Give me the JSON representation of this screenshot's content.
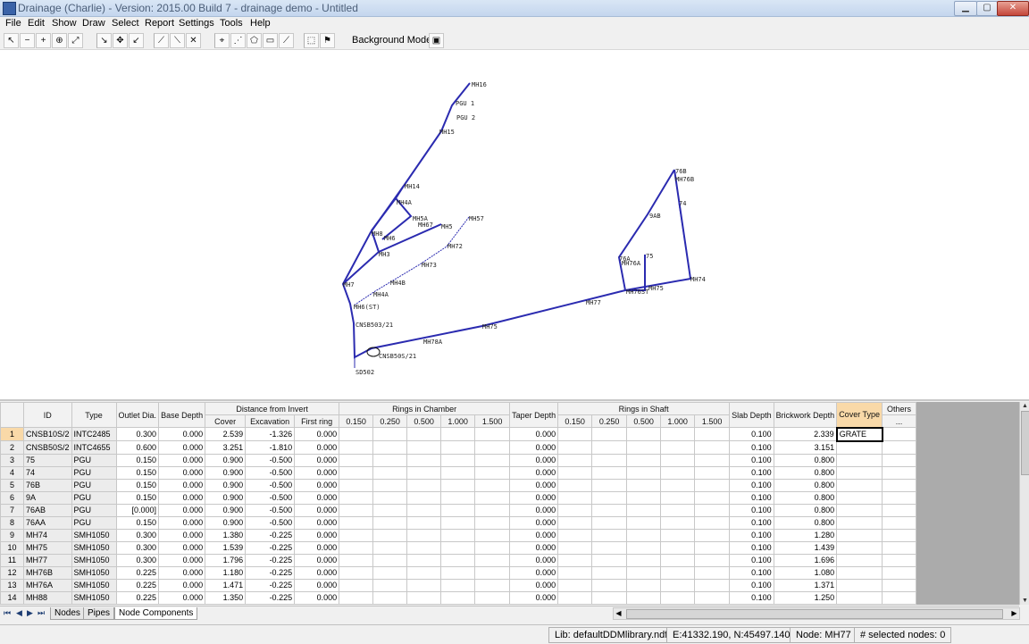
{
  "window": {
    "title": "Drainage (Charlie) - Version: 2015.00 Build 7 - drainage demo - Untitled"
  },
  "menu": [
    "File",
    "Edit",
    "Show",
    "Draw",
    "Select",
    "Report",
    "Settings",
    "Tools",
    "Help"
  ],
  "toolbar": {
    "background_label": "Background Models:"
  },
  "map": {
    "node_labels": [
      "MH16",
      "PGU 1",
      "PGU 2",
      "MH15",
      "MH14",
      "MH4A",
      "MH5A",
      "MH67",
      "MH8",
      "MH6",
      "MH5",
      "MH57",
      "MH72",
      "MH3",
      "MH73",
      "MH4B",
      "MH7",
      "MH4A",
      "MH6(ST)",
      "CNSB503/21",
      "MH78A",
      "MH75",
      "CNSB50S/21",
      "SD502",
      "MH77",
      "MH76ST",
      "MH75",
      "MH74",
      "76B",
      "MH76B",
      "74",
      "9AB",
      "76A",
      "MH76A",
      "75"
    ]
  },
  "grid": {
    "group_headers": {
      "distance": "Distance from Invert",
      "rings_chamber": "Rings in Chamber",
      "rings_shaft": "Rings in Shaft"
    },
    "columns": {
      "id": "ID",
      "type": "Type",
      "outlet": "Outlet Dia.",
      "base": "Base Depth",
      "cover": "Cover",
      "excavation": "Excavation",
      "first_ring": "First ring",
      "taper": "Taper Depth",
      "slab": "Slab Depth",
      "brickwork": "Brickwork Depth",
      "cover_type": "Cover Type",
      "others": "Others",
      "others_sub": "..."
    },
    "ring_sizes": [
      "0.150",
      "0.250",
      "0.500",
      "1.000",
      "1.500"
    ],
    "rows": [
      {
        "n": "1",
        "id": "CNSB10S/2",
        "type": "INTC2485",
        "outlet": "0.300",
        "base": "0.000",
        "cover": "2.539",
        "exc": "-1.326",
        "first": "0.000",
        "taper": "0.000",
        "slab": "0.100",
        "brick": "2.339",
        "ctype": "GRATE"
      },
      {
        "n": "2",
        "id": "CNSB50S/2",
        "type": "INTC4655",
        "outlet": "0.600",
        "base": "0.000",
        "cover": "3.251",
        "exc": "-1.810",
        "first": "0.000",
        "taper": "0.000",
        "slab": "0.100",
        "brick": "3.151",
        "ctype": ""
      },
      {
        "n": "3",
        "id": "75",
        "type": "PGU",
        "outlet": "0.150",
        "base": "0.000",
        "cover": "0.900",
        "exc": "-0.500",
        "first": "0.000",
        "taper": "0.000",
        "slab": "0.100",
        "brick": "0.800",
        "ctype": ""
      },
      {
        "n": "4",
        "id": "74",
        "type": "PGU",
        "outlet": "0.150",
        "base": "0.000",
        "cover": "0.900",
        "exc": "-0.500",
        "first": "0.000",
        "taper": "0.000",
        "slab": "0.100",
        "brick": "0.800",
        "ctype": ""
      },
      {
        "n": "5",
        "id": "76B",
        "type": "PGU",
        "outlet": "0.150",
        "base": "0.000",
        "cover": "0.900",
        "exc": "-0.500",
        "first": "0.000",
        "taper": "0.000",
        "slab": "0.100",
        "brick": "0.800",
        "ctype": ""
      },
      {
        "n": "6",
        "id": "9A",
        "type": "PGU",
        "outlet": "0.150",
        "base": "0.000",
        "cover": "0.900",
        "exc": "-0.500",
        "first": "0.000",
        "taper": "0.000",
        "slab": "0.100",
        "brick": "0.800",
        "ctype": ""
      },
      {
        "n": "7",
        "id": "76AB",
        "type": "PGU",
        "outlet": "[0.000]",
        "base": "0.000",
        "cover": "0.900",
        "exc": "-0.500",
        "first": "0.000",
        "taper": "0.000",
        "slab": "0.100",
        "brick": "0.800",
        "ctype": ""
      },
      {
        "n": "8",
        "id": "76AA",
        "type": "PGU",
        "outlet": "0.150",
        "base": "0.000",
        "cover": "0.900",
        "exc": "-0.500",
        "first": "0.000",
        "taper": "0.000",
        "slab": "0.100",
        "brick": "0.800",
        "ctype": ""
      },
      {
        "n": "9",
        "id": "MH74",
        "type": "SMH1050",
        "outlet": "0.300",
        "base": "0.000",
        "cover": "1.380",
        "exc": "-0.225",
        "first": "0.000",
        "taper": "0.000",
        "slab": "0.100",
        "brick": "1.280",
        "ctype": ""
      },
      {
        "n": "10",
        "id": "MH75",
        "type": "SMH1050",
        "outlet": "0.300",
        "base": "0.000",
        "cover": "1.539",
        "exc": "-0.225",
        "first": "0.000",
        "taper": "0.000",
        "slab": "0.100",
        "brick": "1.439",
        "ctype": ""
      },
      {
        "n": "11",
        "id": "MH77",
        "type": "SMH1050",
        "outlet": "0.300",
        "base": "0.000",
        "cover": "1.796",
        "exc": "-0.225",
        "first": "0.000",
        "taper": "0.000",
        "slab": "0.100",
        "brick": "1.696",
        "ctype": ""
      },
      {
        "n": "12",
        "id": "MH76B",
        "type": "SMH1050",
        "outlet": "0.225",
        "base": "0.000",
        "cover": "1.180",
        "exc": "-0.225",
        "first": "0.000",
        "taper": "0.000",
        "slab": "0.100",
        "brick": "1.080",
        "ctype": ""
      },
      {
        "n": "13",
        "id": "MH76A",
        "type": "SMH1050",
        "outlet": "0.225",
        "base": "0.000",
        "cover": "1.471",
        "exc": "-0.225",
        "first": "0.000",
        "taper": "0.000",
        "slab": "0.100",
        "brick": "1.371",
        "ctype": ""
      },
      {
        "n": "14",
        "id": "MH88",
        "type": "SMH1050",
        "outlet": "0.225",
        "base": "0.000",
        "cover": "1.350",
        "exc": "-0.225",
        "first": "0.000",
        "taper": "0.000",
        "slab": "0.100",
        "brick": "1.250",
        "ctype": ""
      }
    ]
  },
  "tabs": [
    "Nodes",
    "Pipes",
    "Node Components"
  ],
  "status": {
    "lib": "Lib: defaultDDMlibrary.ndf",
    "coords": "E:41332.190, N:45497.140",
    "node": "Node: MH77",
    "selected": "# selected nodes: 0"
  }
}
